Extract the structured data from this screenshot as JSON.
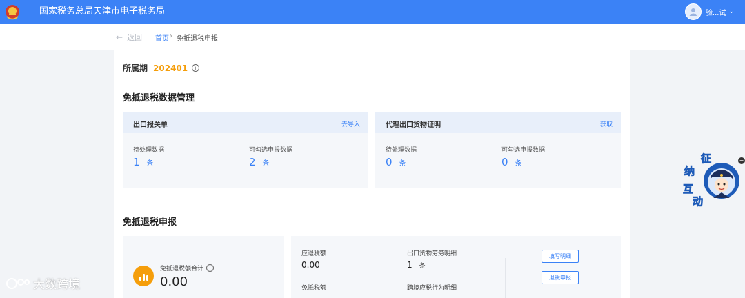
{
  "header": {
    "site_title": "国家税务总局天津市电子税务局",
    "user_name": "验...试",
    "icons": {
      "logo": "tax-emblem-icon",
      "avatar": "user-avatar-icon",
      "dropdown": "chevron-down-icon"
    },
    "colors": {
      "bar": "#3b82f6"
    }
  },
  "breadcrumb": {
    "back_label": "返回",
    "home": "首页",
    "separator": "›",
    "current": "免抵退税申报"
  },
  "period": {
    "label": "所属期",
    "value": "202401"
  },
  "data_mgmt": {
    "title": "免抵退税数据管理",
    "cards": [
      {
        "title": "出口报关单",
        "link": "去导入",
        "pending_label": "待处理数据",
        "pending_value": "1",
        "pending_unit": "条",
        "selectable_label": "可勾选申报数据",
        "selectable_value": "2",
        "selectable_unit": "条"
      },
      {
        "title": "代理出口货物证明",
        "link": "获取",
        "pending_label": "待处理数据",
        "pending_value": "0",
        "pending_unit": "条",
        "selectable_label": "可勾选申报数据",
        "selectable_value": "0",
        "selectable_unit": "条"
      }
    ]
  },
  "declaration": {
    "title": "免抵退税申报",
    "total_label": "免抵退税额合计",
    "total_value": "0.00",
    "refund_label": "应退税额",
    "refund_value": "0.00",
    "exempt_label": "免抵税额",
    "export_detail_label": "出口货物劳务明细",
    "export_detail_value": "1",
    "export_detail_unit": "条",
    "cross_label": "跨境应税行为明细",
    "fill_button": "填写明细",
    "refund_button": "退税申报",
    "colors": {
      "accent": "#f59e0b",
      "primary": "#3b82f6"
    }
  },
  "float_widget": {
    "chars": [
      "征",
      "纳",
      "互",
      "动"
    ]
  },
  "watermark": {
    "text": "大数跨境"
  }
}
